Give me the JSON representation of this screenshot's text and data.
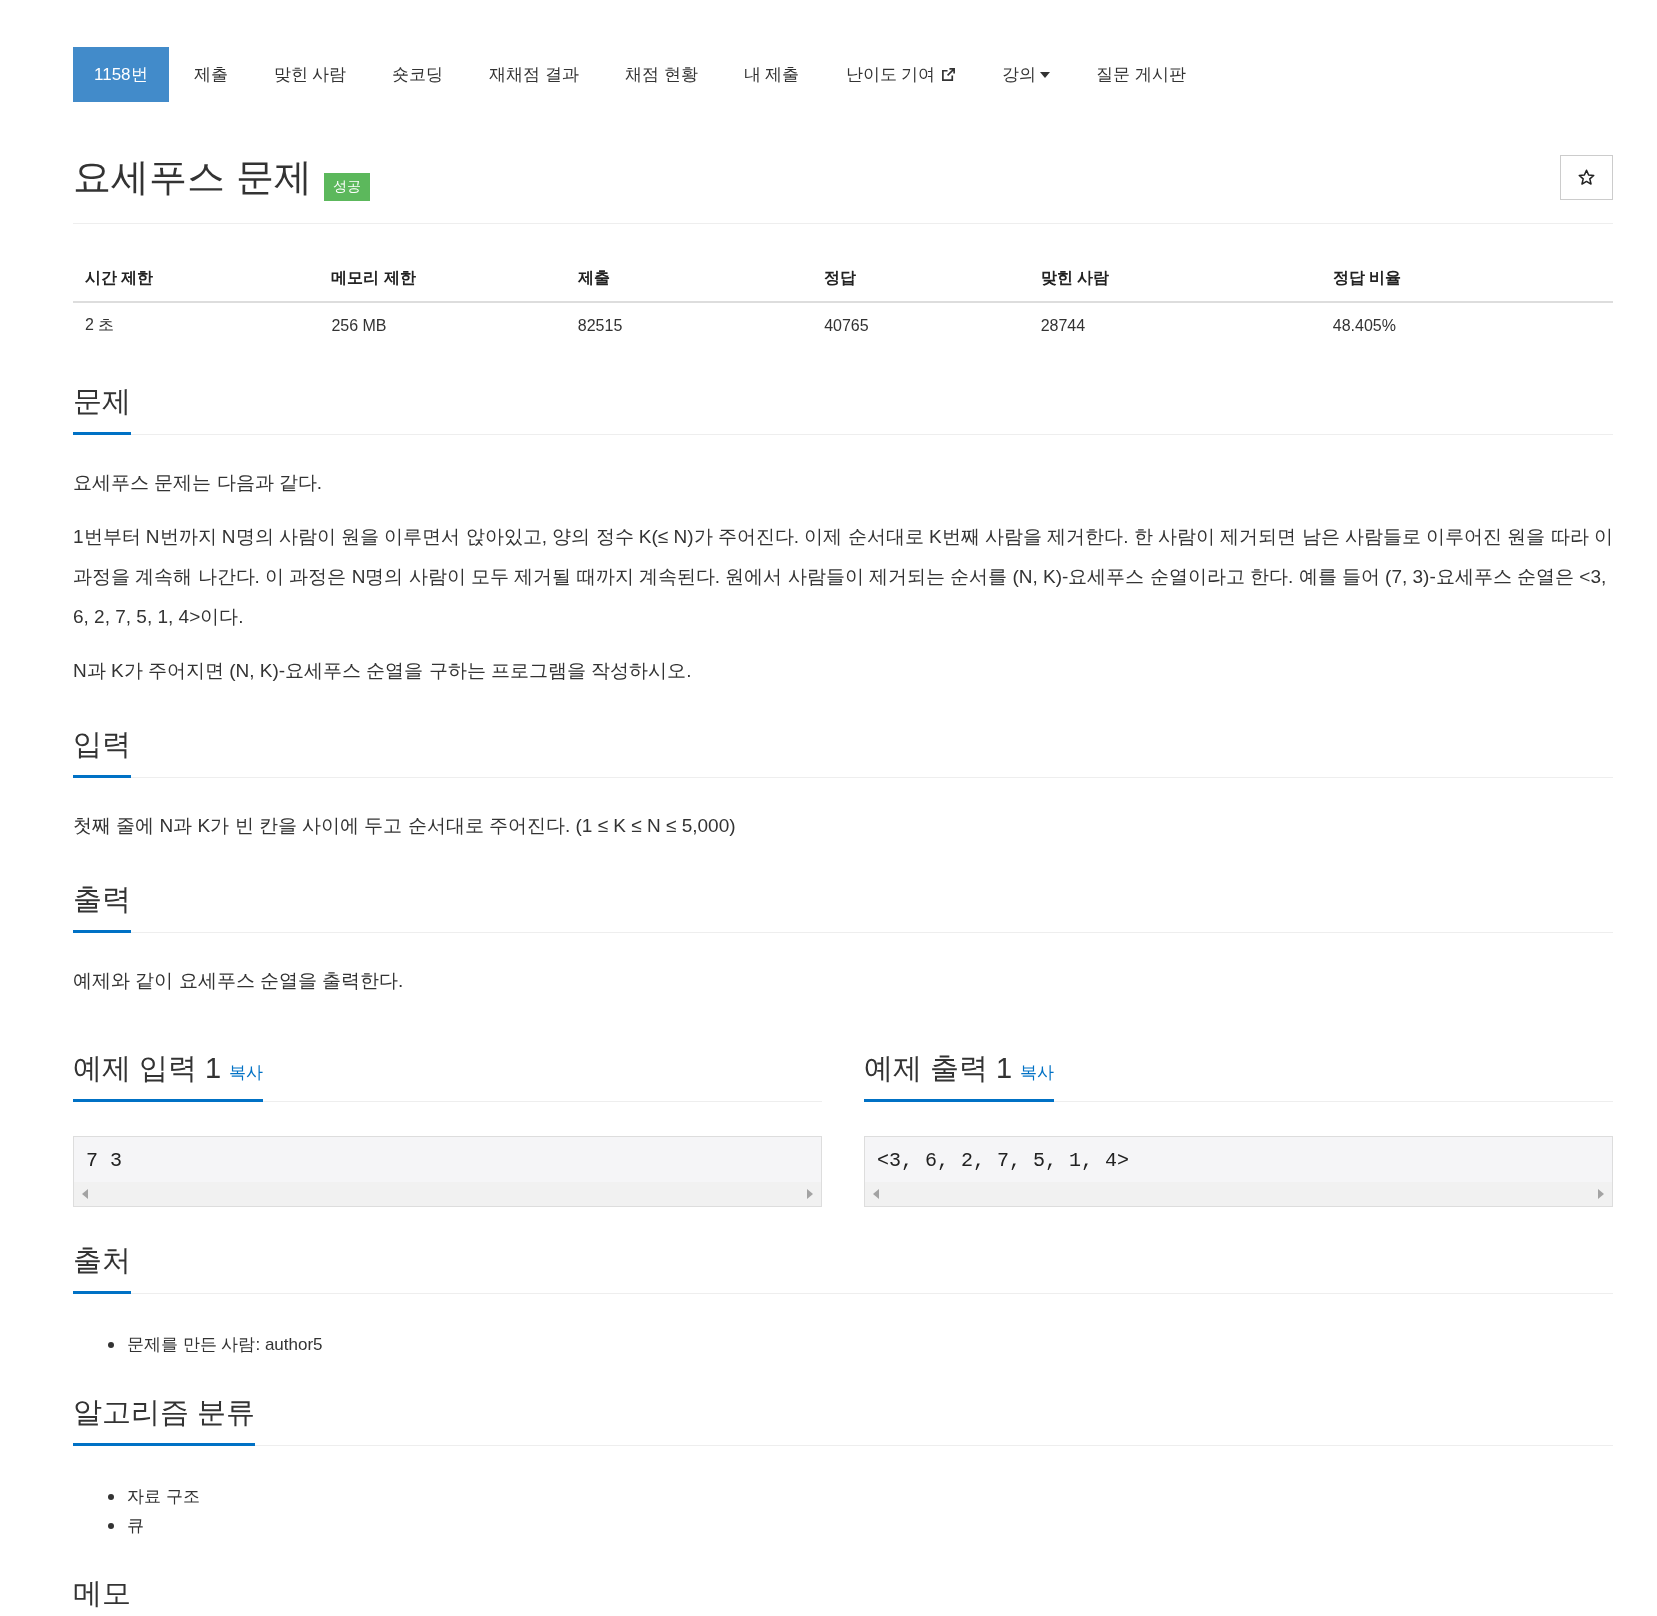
{
  "nav": [
    {
      "label": "1158번",
      "selected": true,
      "kind": "plain"
    },
    {
      "label": "제출",
      "selected": false,
      "kind": "plain"
    },
    {
      "label": "맞힌 사람",
      "selected": false,
      "kind": "plain"
    },
    {
      "label": "숏코딩",
      "selected": false,
      "kind": "plain"
    },
    {
      "label": "재채점 결과",
      "selected": false,
      "kind": "plain"
    },
    {
      "label": "채점 현황",
      "selected": false,
      "kind": "plain"
    },
    {
      "label": "내 제출",
      "selected": false,
      "kind": "plain"
    },
    {
      "label": "난이도 기여",
      "selected": false,
      "kind": "external"
    },
    {
      "label": "강의",
      "selected": false,
      "kind": "dropdown"
    },
    {
      "label": "질문 게시판",
      "selected": false,
      "kind": "plain"
    }
  ],
  "title": "요세푸스 문제",
  "badge": "성공",
  "stats": {
    "columns": [
      "시간 제한",
      "메모리 제한",
      "제출",
      "정답",
      "맞힌 사람",
      "정답 비율"
    ],
    "values": [
      "2 초",
      "256 MB",
      "82515",
      "40765",
      "28744",
      "48.405%"
    ]
  },
  "sections": [
    {
      "kind": "text",
      "heading": "문제",
      "paragraphs": [
        "요세푸스 문제는 다음과 같다.",
        "1번부터 N번까지 N명의 사람이 원을 이루면서 앉아있고, 양의 정수 K(≤ N)가 주어진다. 이제 순서대로 K번째 사람을 제거한다. 한 사람이 제거되면 남은 사람들로 이루어진 원을 따라 이 과정을 계속해 나간다. 이 과정은 N명의 사람이 모두 제거될 때까지 계속된다. 원에서 사람들이 제거되는 순서를 (N, K)-요세푸스 순열이라고 한다. 예를 들어 (7, 3)-요세푸스 순열은 <3, 6, 2, 7, 5, 1, 4>이다.",
        "N과 K가 주어지면 (N, K)-요세푸스 순열을 구하는 프로그램을 작성하시오."
      ]
    },
    {
      "kind": "text",
      "heading": "입력",
      "paragraphs": [
        "첫째 줄에 N과 K가 빈 칸을 사이에 두고 순서대로 주어진다. (1 ≤ K ≤ N ≤ 5,000)"
      ]
    },
    {
      "kind": "text",
      "heading": "출력",
      "paragraphs": [
        "예제와 같이 요세푸스 순열을 출력한다."
      ]
    },
    {
      "kind": "samples",
      "samples": [
        {
          "heading": "예제 입력 1",
          "copy": "복사",
          "content": "7 3"
        },
        {
          "heading": "예제 출력 1",
          "copy": "복사",
          "content": "<3, 6, 2, 7, 5, 1, 4>"
        }
      ]
    },
    {
      "kind": "list",
      "heading": "출처",
      "items": [
        "문제를 만든 사람: author5"
      ]
    },
    {
      "kind": "list",
      "heading": "알고리즘 분류",
      "items": [
        "자료 구조",
        "큐"
      ]
    },
    {
      "kind": "text",
      "heading": "메모"
    }
  ]
}
